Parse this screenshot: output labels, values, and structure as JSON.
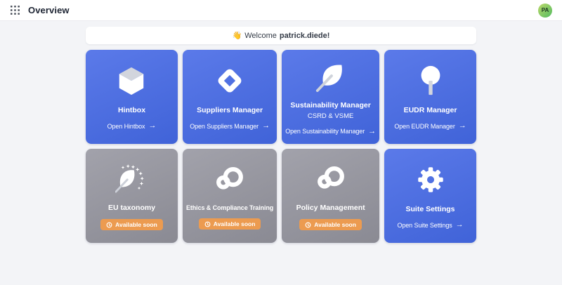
{
  "topbar": {
    "title": "Overview",
    "avatar_initials": "PA"
  },
  "welcome": {
    "emoji": "👋",
    "greeting": "Welcome",
    "username": "patrick.diede!"
  },
  "ui": {
    "arrow": "→"
  },
  "colors": {
    "card_blue": "#4a6ce0",
    "card_gray": "#909098",
    "badge_orange": "#ec9b50",
    "avatar_green": "#7ac466",
    "page_bg": "#f3f4f7",
    "topbar_bg": "#ffffff"
  },
  "cards": [
    {
      "title": "Hintbox",
      "link_label": "Open Hintbox",
      "icon": "cube-icon",
      "state": "active"
    },
    {
      "title": "Suppliers Manager",
      "link_label": "Open Suppliers Manager",
      "icon": "diamond-icon",
      "state": "active"
    },
    {
      "title": "Sustainability Manager",
      "subtitle": "CSRD & VSME",
      "link_label": "Open Sustainability Manager",
      "icon": "leaf-icon",
      "state": "active"
    },
    {
      "title": "EUDR Manager",
      "link_label": "Open EUDR Manager",
      "icon": "tree-icon",
      "state": "active"
    },
    {
      "title": "EU taxonomy",
      "badge": "Available soon",
      "icon": "eu-leaf-icon",
      "state": "coming-soon"
    },
    {
      "title": "Ethics & Compliance Training",
      "badge": "Available soon",
      "icon": "loop-icon",
      "state": "coming-soon"
    },
    {
      "title": "Policy Management",
      "badge": "Available soon",
      "icon": "loop-icon",
      "state": "coming-soon"
    },
    {
      "title": "Suite Settings",
      "link_label": "Open Suite Settings",
      "icon": "gear-icon",
      "state": "active"
    }
  ]
}
